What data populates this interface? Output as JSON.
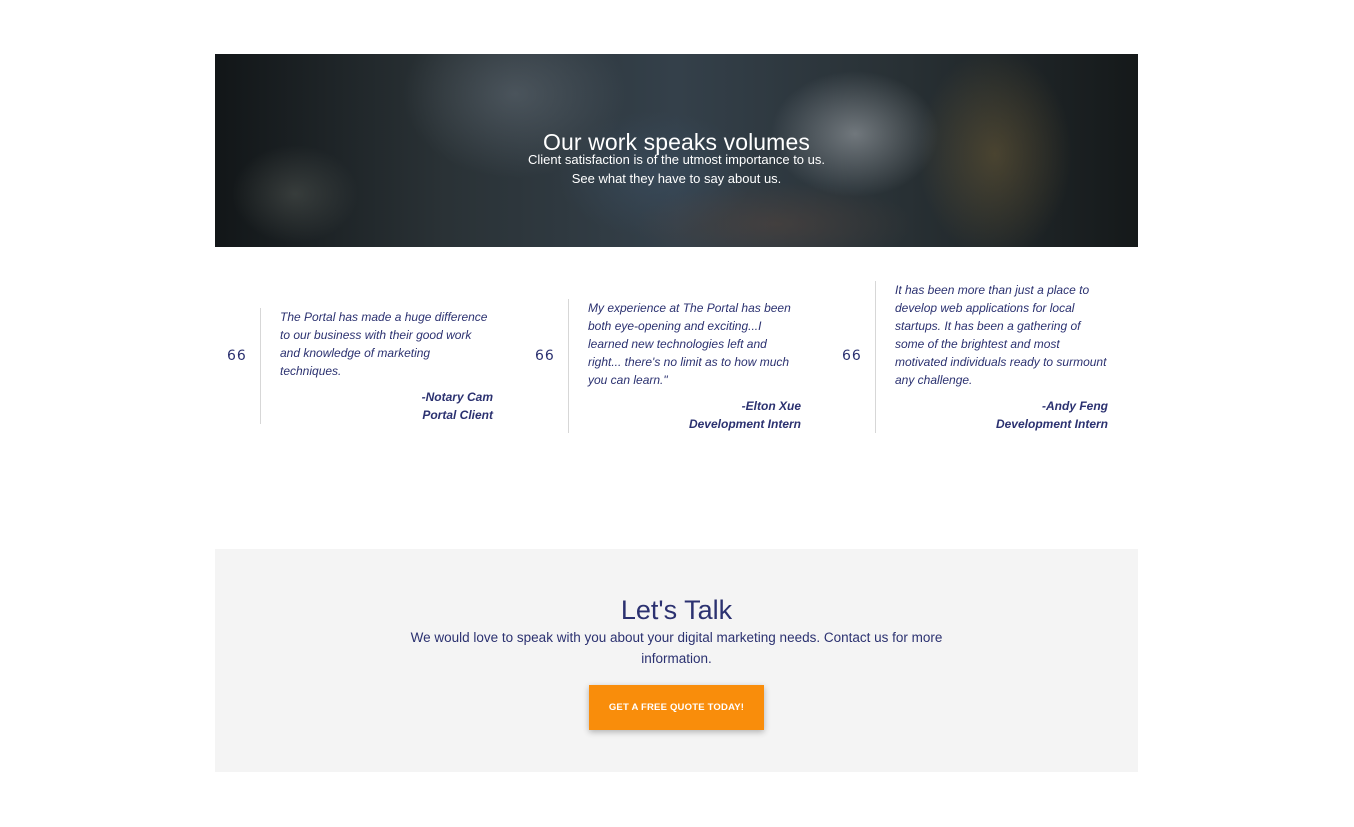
{
  "hero": {
    "title": "Our work speaks volumes",
    "subtitle_line1": "Client satisfaction is of the utmost importance to us.",
    "subtitle_line2": "See what they have to say about us."
  },
  "testimonials": [
    {
      "quote_mark": "66",
      "text": "The Portal has made a huge difference to our business with their good work and knowledge of marketing techniques.",
      "author": "-Notary Cam",
      "role": "Portal Client"
    },
    {
      "quote_mark": "66",
      "text": "My experience at The Portal has been both eye-opening and exciting...I learned new technologies left and right... there's no limit as to how much you can learn.\"",
      "author": "-Elton Xue",
      "role": "Development Intern"
    },
    {
      "quote_mark": "66",
      "text": "It has been more than just a place to develop web applications for local startups. It has been a gathering of some of the brightest and most motivated individuals ready to surmount any challenge.",
      "author": "-Andy Feng",
      "role": "Development Intern"
    }
  ],
  "cta": {
    "title": "Let's Talk",
    "text": "We would love to speak with you about your digital marketing needs. Contact us for more information.",
    "button_label": "GET A FREE QUOTE TODAY!"
  },
  "colors": {
    "navy": "#2b3170",
    "orange": "#f98d0b",
    "panel_bg": "#f4f4f4"
  }
}
